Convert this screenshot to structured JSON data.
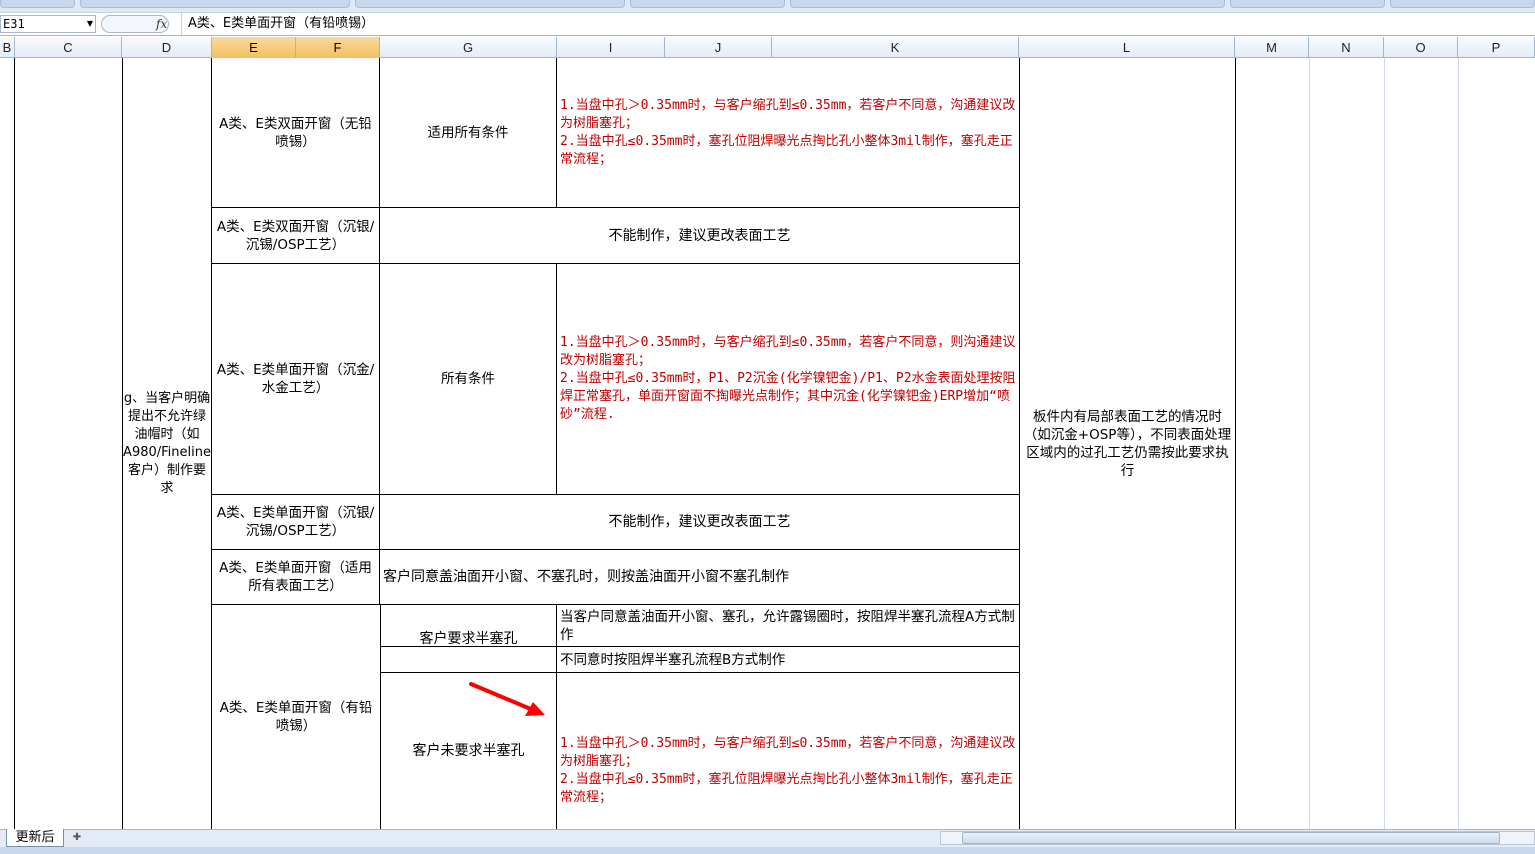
{
  "namebox": "E31",
  "formula": "A类、E类单面开窗（有铅喷锡）",
  "columns": [
    "B",
    "C",
    "D",
    "E",
    "F",
    "G",
    "I",
    "J",
    "K",
    "L",
    "M",
    "N",
    "O",
    "P"
  ],
  "cells": {
    "d_merged": "g、当客户明确提出不允许绿油帽时（如A980/Fineline客户）制作要求",
    "r1_e": "A类、E类双面开窗（无铅喷锡）",
    "r1_g": "适用所有条件",
    "r1_i_1": "1.当盘中孔＞0.35mm时，与客户缩孔到≤0.35mm，若客户不同意，沟通建议改为树脂塞孔；",
    "r1_i_2": "2.当盘中孔≤0.35mm时，塞孔位阻焊曝光点掏比孔小整体3mil制作，塞孔走正常流程；",
    "r2_e": "A类、E类双面开窗（沉银/沉锡/OSP工艺）",
    "r2_g": "不能制作，建议更改表面工艺",
    "r3_e": "A类、E类单面开窗（沉金/水金工艺）",
    "r3_g": "所有条件",
    "r3_i_1": "1.当盘中孔＞0.35mm时，与客户缩孔到≤0.35mm，若客户不同意，则沟通建议改为树脂塞孔；",
    "r3_i_2": "2.当盘中孔≤0.35mm时，P1、P2沉金(化学镍钯金)/P1、P2水金表面处理按阻焊正常塞孔，单面开窗面不掏曝光点制作；其中沉金(化学镍钯金)ERP增加“喷砂”流程.",
    "l_merged": "板件内有局部表面工艺的情况时（如沉金+OSP等），不同表面处理区域内的过孔工艺仍需按此要求执行",
    "r4_e": "A类、E类单面开窗（沉银/沉锡/OSP工艺）",
    "r4_g": "不能制作，建议更改表面工艺",
    "r5_e": "A类、E类单面开窗（适用所有表面工艺）",
    "r5_g": "客户同意盖油面开小窗、不塞孔时，则按盖油面开小窗不塞孔制作",
    "r6_e": "A类、E类单面开窗（有铅喷锡）",
    "r6_g1": "客户要求半塞孔",
    "r6_i1": "当客户同意盖油面开小窗、塞孔，允许露锡圈时，按阻焊半塞孔流程A方式制作",
    "r6_i2": "不同意时按阻焊半塞孔流程B方式制作",
    "r6_g2": "客户未要求半塞孔",
    "r6_i3_1": "1.当盘中孔＞0.35mm时，与客户缩孔到≤0.35mm，若客户不同意，沟通建议改为树脂塞孔；",
    "r6_i3_2": "2.当盘中孔≤0.35mm时，塞孔位阻焊曝光点掏比孔小整体3mil制作，塞孔走正常流程；"
  },
  "sheet_tab": "更新后",
  "colors": {
    "red_text": "#c00000",
    "arrow": "#ff0000",
    "selected_header": "#f1c15f"
  },
  "icons": {
    "fx": "function-icon",
    "annotation": "red-arrow-icon"
  }
}
